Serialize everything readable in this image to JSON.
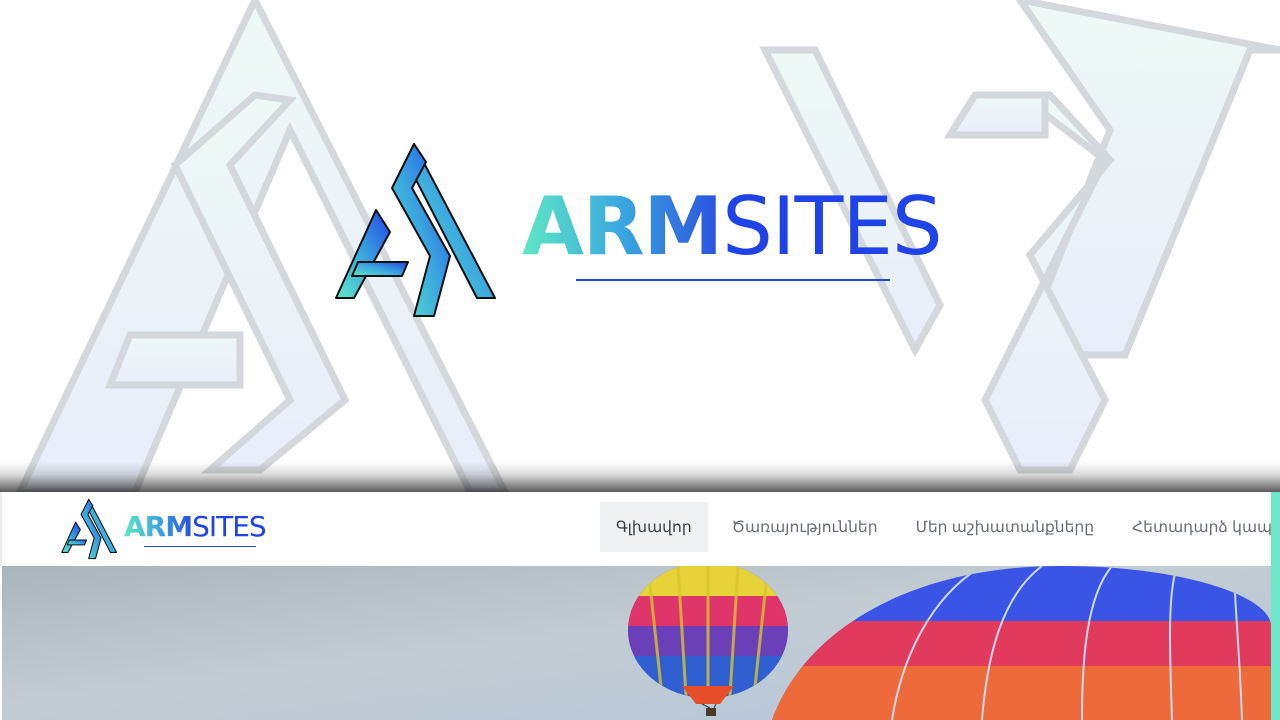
{
  "brand": {
    "name_part1": "ARM",
    "name_part2": "SITES",
    "logo_mark": "as-monogram-logo",
    "colors": {
      "teal": "#5ee8c4",
      "blue": "#1f43e6",
      "accent": "#6fe6c7"
    }
  },
  "nav": {
    "items": [
      {
        "label": "Գլխավոր",
        "active": true
      },
      {
        "label": "Ծառայություններ",
        "active": false
      },
      {
        "label": "Մեր աշխատանքները",
        "active": false
      },
      {
        "label": "Հետադարձ կապ",
        "active": false
      }
    ]
  },
  "banner": {
    "image": "hot-air-balloons-photo"
  }
}
